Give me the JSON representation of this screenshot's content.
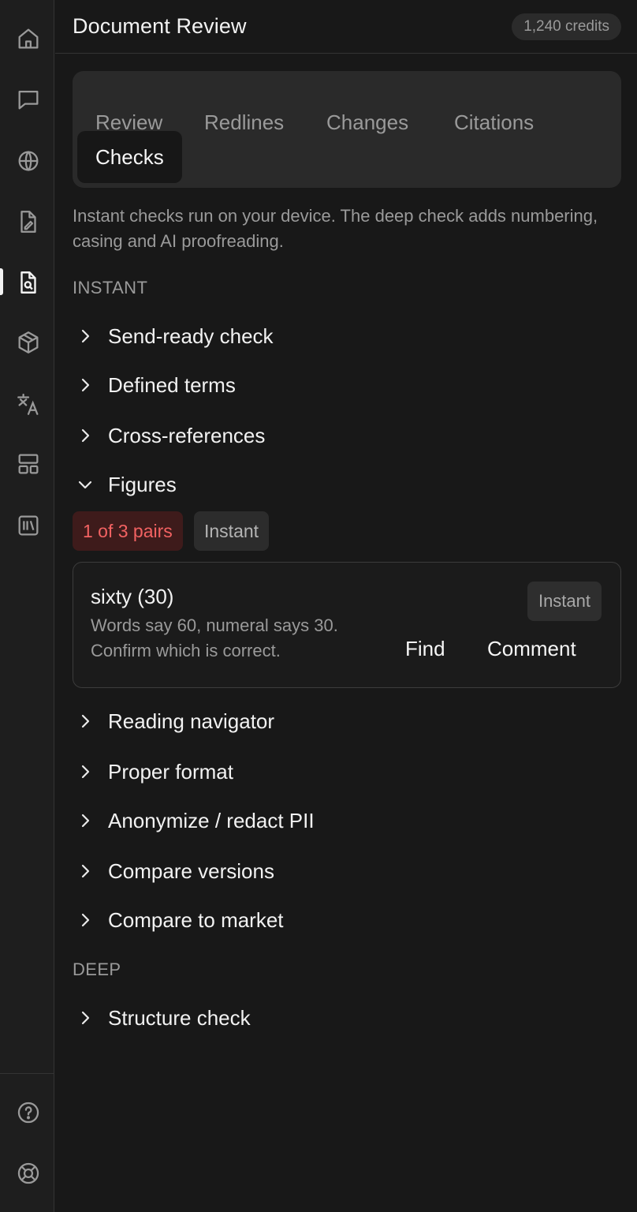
{
  "header": {
    "title": "Document Review",
    "credits": "1,240 credits"
  },
  "rail": {
    "top_icons": [
      "home-icon",
      "chat-icon",
      "globe-icon",
      "file-edit-icon",
      "file-search-icon",
      "package-icon",
      "translate-icon",
      "layout-icon",
      "library-icon"
    ],
    "bottom_icons": [
      "help-icon",
      "lifebuoy-icon"
    ],
    "active": "file-search-icon"
  },
  "tabs": [
    {
      "label": "Review",
      "active": false
    },
    {
      "label": "Redlines",
      "active": false
    },
    {
      "label": "Changes",
      "active": false
    },
    {
      "label": "Citations",
      "active": false
    },
    {
      "label": "Checks",
      "active": true
    }
  ],
  "intro": "Instant checks run on your device. The deep check adds numbering, casing and AI proofreading.",
  "sections": {
    "instant": {
      "label": "INSTANT",
      "items": [
        {
          "label": "Send-ready check",
          "expanded": false
        },
        {
          "label": "Defined terms",
          "expanded": false
        },
        {
          "label": "Cross-references",
          "expanded": false
        },
        {
          "label": "Figures",
          "expanded": true
        },
        {
          "label": "Reading navigator",
          "expanded": false
        },
        {
          "label": "Proper format",
          "expanded": false
        },
        {
          "label": "Anonymize / redact PII",
          "expanded": false
        },
        {
          "label": "Compare versions",
          "expanded": false
        },
        {
          "label": "Compare to market",
          "expanded": false
        }
      ]
    },
    "deep": {
      "label": "DEEP",
      "items": [
        {
          "label": "Structure check",
          "expanded": false
        }
      ]
    }
  },
  "figures": {
    "count_pill": "1 of 3 pairs",
    "mode_pill": "Instant",
    "finding": {
      "title": "sixty (30)",
      "description": "Words say 60, numeral says 30. Confirm which is correct.",
      "badge": "Instant",
      "find_label": "Find",
      "comment_label": "Comment"
    }
  },
  "colors": {
    "background": "#181818",
    "rail": "#1e1e1e",
    "warning": "#f26262",
    "warning_bg": "#3e1b1b"
  }
}
